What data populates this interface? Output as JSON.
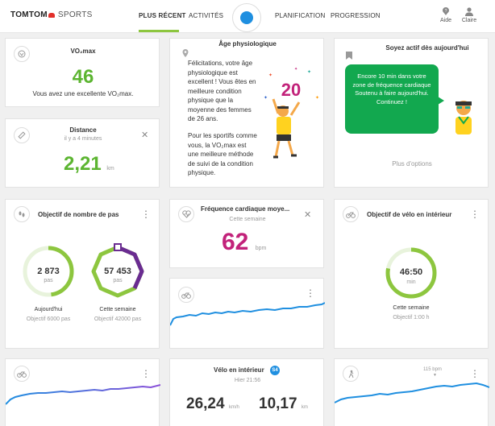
{
  "header": {
    "logo_main": "TOMTOM",
    "logo_sub": "SPORTS",
    "nav": [
      {
        "label": "PLUS RÉCENT",
        "active": true
      },
      {
        "label": "ACTIVITÉS",
        "active": false
      },
      {
        "label": "PLANIFICATION",
        "active": false
      },
      {
        "label": "PROGRESSION",
        "active": false
      }
    ],
    "help_label": "Aide",
    "user_label": "Claire"
  },
  "vo2": {
    "title": "VO₂max",
    "value": "46",
    "caption": "Vous avez une excellente VO₂max."
  },
  "age": {
    "title": "Âge physiologique",
    "para1": "Félicitations, votre âge physiologique est excellent ! Vous êtes en meilleure condition physique que la moyenne des femmes de 26 ans.",
    "para2": "Pour les sportifs comme vous, la VO₂max est une meilleure méthode de suivi de la condition physique.",
    "badge": "20"
  },
  "active": {
    "title": "Soyez actif dès aujourd'hui",
    "bubble": "Encore 10 min dans votre zone de fréquence cardiaque Soutenu à faire aujourd'hui. Continuez !",
    "link": "Plus d'options"
  },
  "distance": {
    "title": "Distance",
    "subtitle": "il y a 4 minutes",
    "value": "2,21",
    "unit": "km"
  },
  "steps": {
    "title": "Objectif de nombre de pas",
    "today_value": "2 873",
    "today_unit": "pas",
    "today_label": "Aujourd'hui",
    "today_goal": "Objectif 6000 pas",
    "today_progress": 0.48,
    "week_value": "57 453",
    "week_unit": "pas",
    "week_label": "Cette semaine",
    "week_goal": "Objectif 42000 pas",
    "week_progress": 1.0
  },
  "heart": {
    "title": "Fréquence cardiaque moye...",
    "subtitle": "Cette semaine",
    "value": "62",
    "unit": "bpm"
  },
  "bike_goal": {
    "title": "Objectif de vélo en intérieur",
    "value": "46:50",
    "unit": "min",
    "label": "Cette semaine",
    "goal": "Objectif 1:00 h",
    "progress": 0.78
  },
  "bike_session": {
    "title": "Vélo en intérieur",
    "badge": "S4",
    "subtitle": "Hier 21:56",
    "speed": "26,24",
    "speed_unit": "km/h",
    "distance": "10,17",
    "distance_unit": "km"
  },
  "run_graph": {
    "peak_label": "115 bpm"
  },
  "colors": {
    "green": "#8dc63f",
    "dark_green": "#5cb531",
    "purple": "#6a2c91",
    "magenta": "#c2227a",
    "blue": "#1f8fe0",
    "bubble_green": "#12a84f"
  }
}
